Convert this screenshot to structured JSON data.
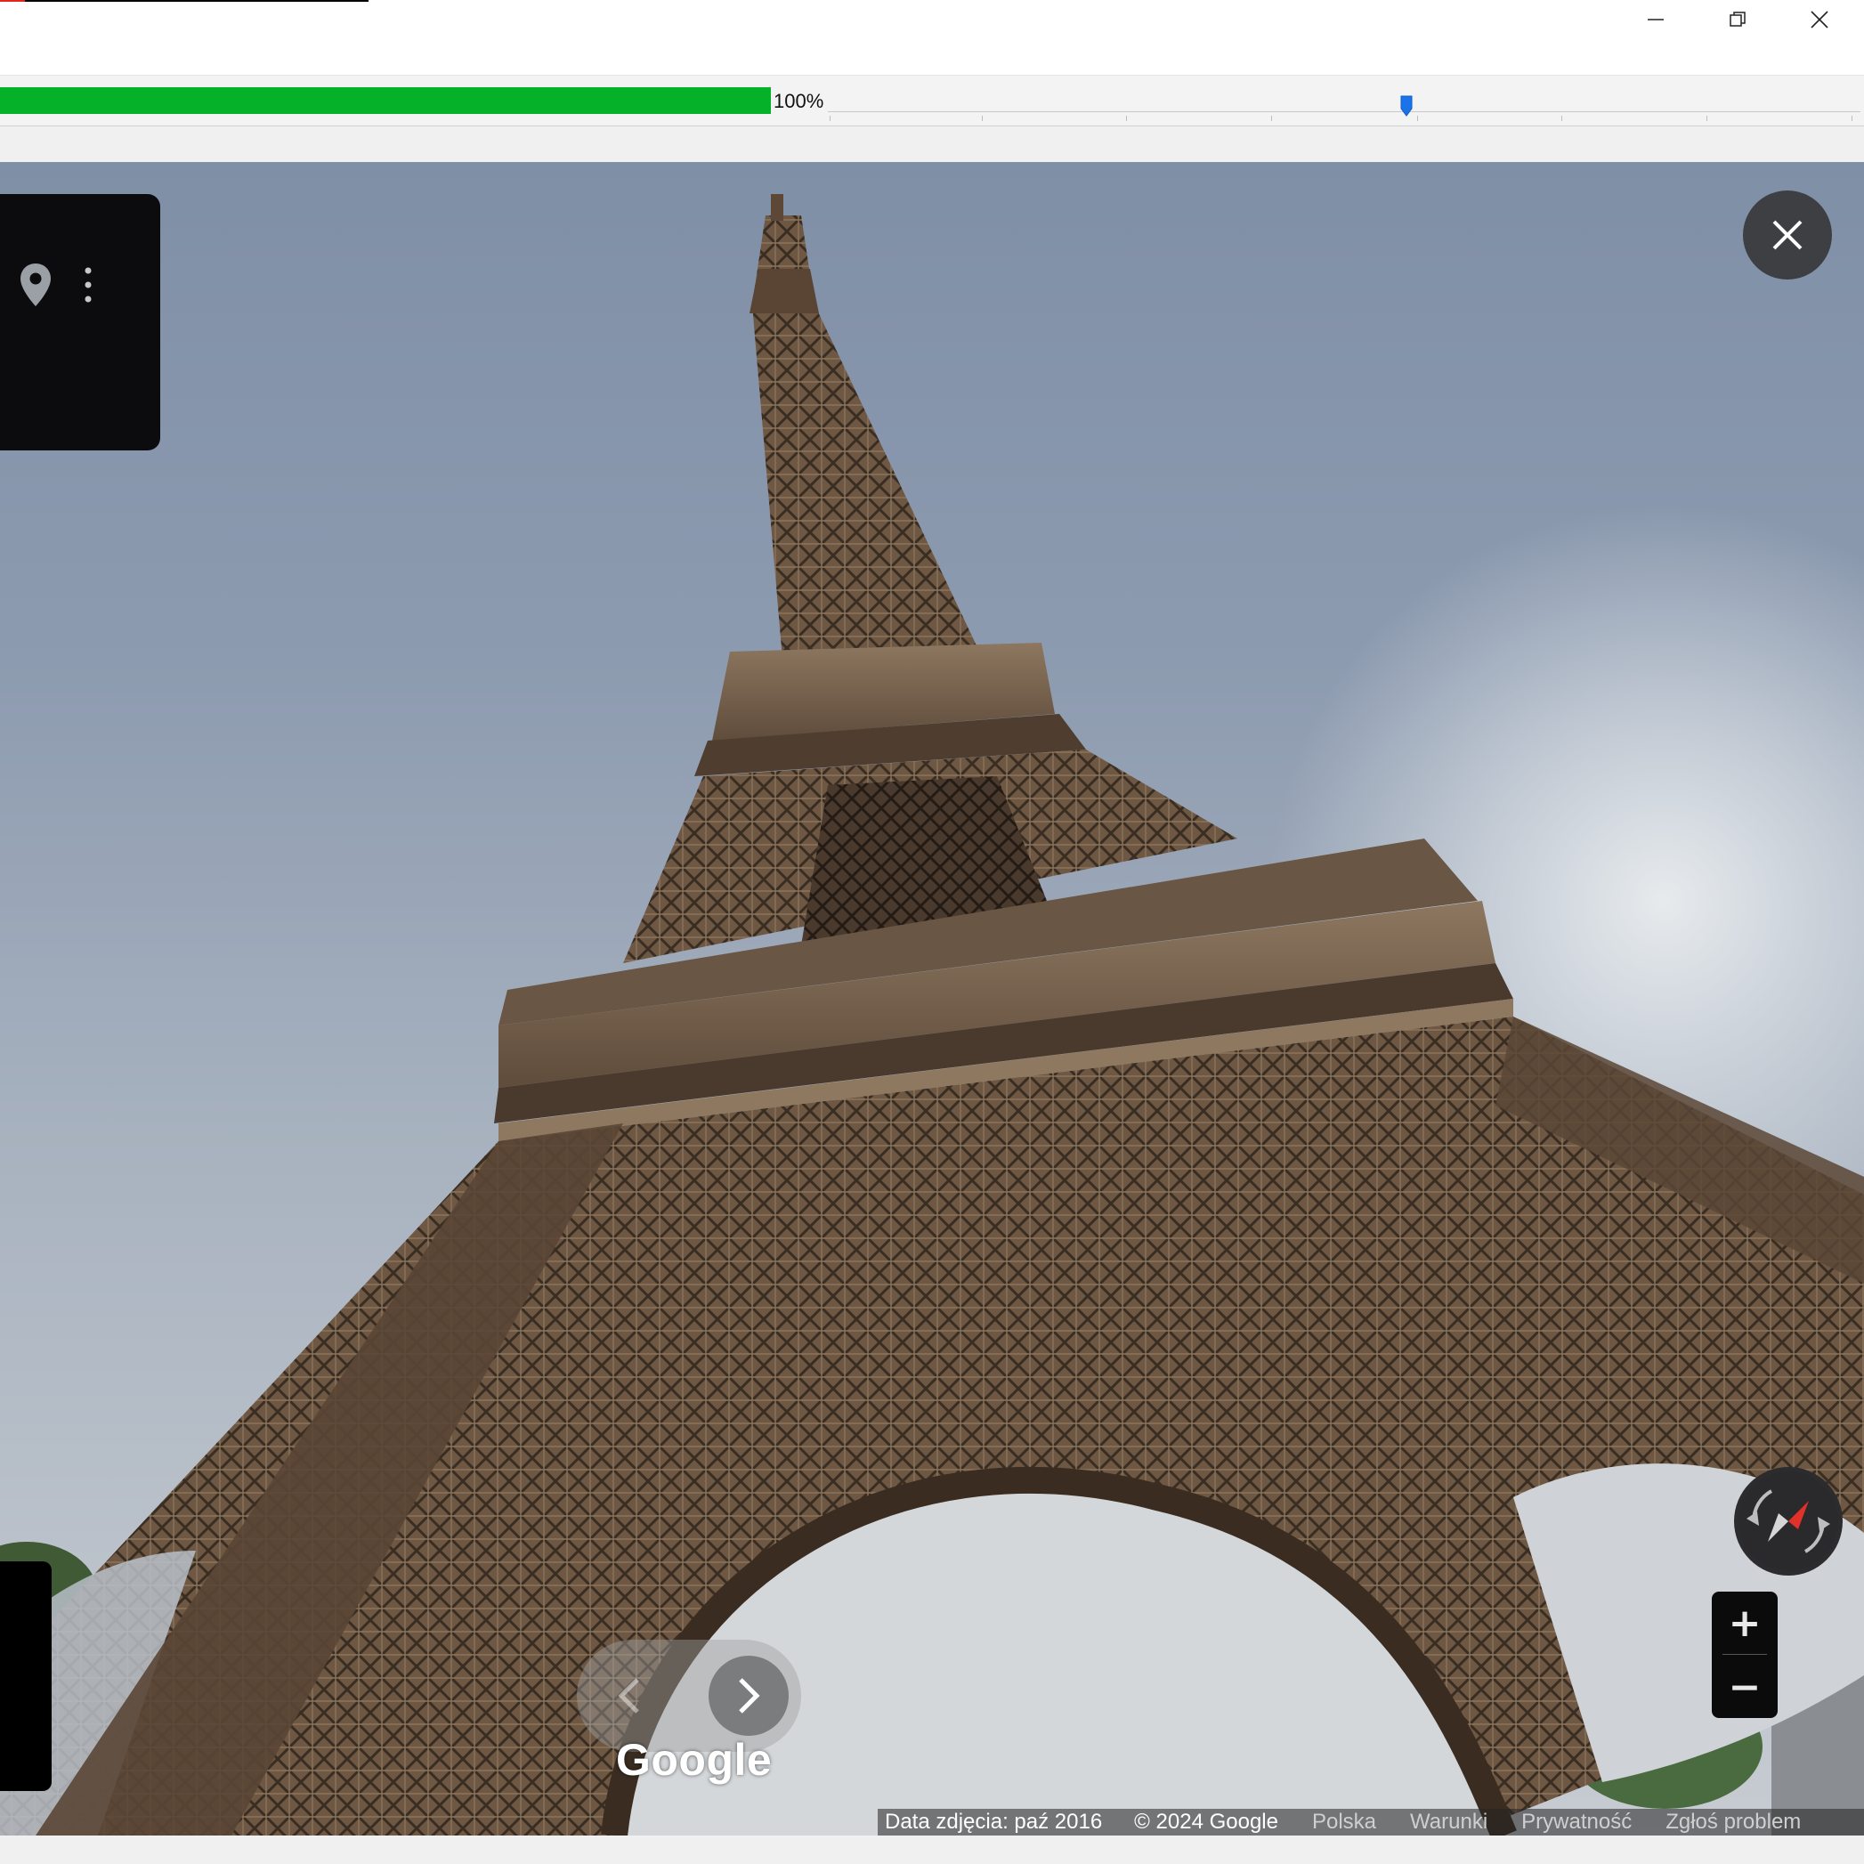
{
  "window": {
    "controls": {
      "minimize_icon": "minimize-icon",
      "restore_icon": "restore-icon",
      "close_icon": "close-icon"
    }
  },
  "progress": {
    "value_text": "100%",
    "value_percent": 100,
    "fill_color": "#06b12a",
    "timeline_thumb_color": "#1a73e8",
    "timeline_position": 0.56
  },
  "panorama": {
    "close_icon": "close-icon",
    "place_icon": "map-pin-icon",
    "more_icon": "more-vertical-icon",
    "compass_icon": "compass-icon",
    "zoom_in_label": "+",
    "zoom_out_label": "−",
    "nav_prev_icon": "chevron-left-icon",
    "nav_next_icon": "chevron-right-icon",
    "logo_text": "Google"
  },
  "footer": {
    "image_date": "Data zdjęcia: paź 2016",
    "copyright": "© 2024 Google",
    "country": "Polska",
    "terms": "Warunki",
    "privacy": "Prywatność",
    "report": "Zgłoś problem"
  }
}
